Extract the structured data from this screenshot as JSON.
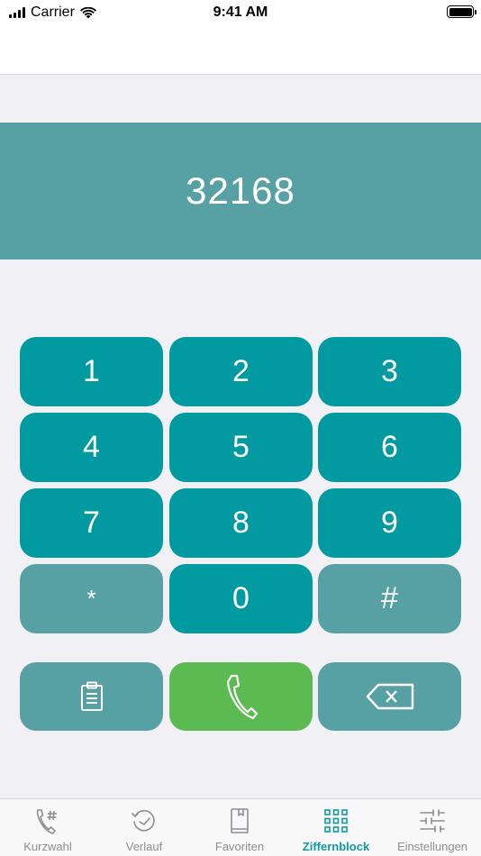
{
  "status_bar": {
    "carrier": "Carrier",
    "time": "9:41 AM"
  },
  "display": {
    "number": "32168"
  },
  "keypad": {
    "keys": [
      {
        "label": "1"
      },
      {
        "label": "2"
      },
      {
        "label": "3"
      },
      {
        "label": "4"
      },
      {
        "label": "5"
      },
      {
        "label": "6"
      },
      {
        "label": "7"
      },
      {
        "label": "8"
      },
      {
        "label": "9"
      },
      {
        "label": "*"
      },
      {
        "label": "0"
      },
      {
        "label": "#"
      }
    ],
    "actions": {
      "paste_icon": "clipboard-icon",
      "call_icon": "phone-icon",
      "delete_icon": "backspace-icon"
    }
  },
  "tabs": [
    {
      "label": "Kurzwahl",
      "icon": "speed-dial-icon",
      "active": false
    },
    {
      "label": "Verlauf",
      "icon": "history-icon",
      "active": false
    },
    {
      "label": "Favoriten",
      "icon": "favorites-book-icon",
      "active": false
    },
    {
      "label": "Ziffernblock",
      "icon": "keypad-icon",
      "active": true
    },
    {
      "label": "Einstellungen",
      "icon": "settings-sliders-icon",
      "active": false
    }
  ],
  "colors": {
    "accent": "#129aa2",
    "key_primary": "#009aa0",
    "key_secondary": "#57a1a5",
    "call_green": "#5bba51",
    "background": "#f1f0f5"
  }
}
